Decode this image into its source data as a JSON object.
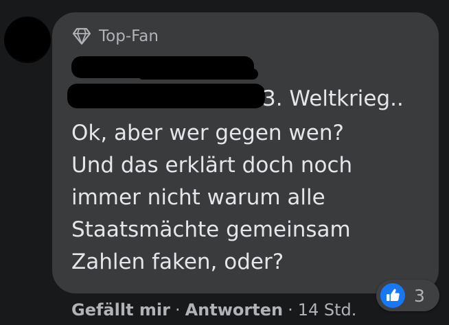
{
  "comment": {
    "badge": {
      "icon": "diamond-icon",
      "label": "Top-Fan"
    },
    "lines": [
      "3. Weltkrieg..",
      "Ok, aber wer gegen wen?",
      "Und das erklärt doch noch",
      "immer nicht warum alle",
      "Staatsmächte gemeinsam",
      "Zahlen faken, oder?"
    ]
  },
  "actions": {
    "like_label": "Gefällt mir",
    "separator": "·",
    "reply_label": "Antworten",
    "timestamp": "14 Std."
  },
  "reactions": {
    "icon": "like-icon",
    "count": "3"
  },
  "colors": {
    "page_background": "#18191a",
    "bubble_background": "#3a3b3c",
    "primary_text": "#e4e6eb",
    "secondary_text": "#b0b3b8",
    "like_blue": "#1877f2"
  }
}
